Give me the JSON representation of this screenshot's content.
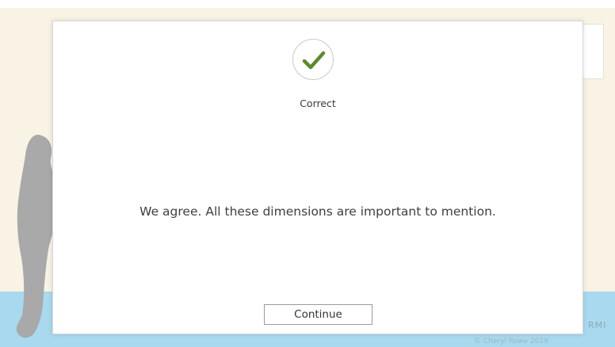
{
  "dialog": {
    "status_label": "Correct",
    "feedback_text": "We agree. All these dimensions are important to mention.",
    "continue_label": "Continue",
    "icon": "checkmark-icon",
    "accent_color": "#5e8a2e"
  },
  "background": {
    "partial_text": "RMI",
    "partial_subtext": "© Cheryl Rowe 2019"
  }
}
